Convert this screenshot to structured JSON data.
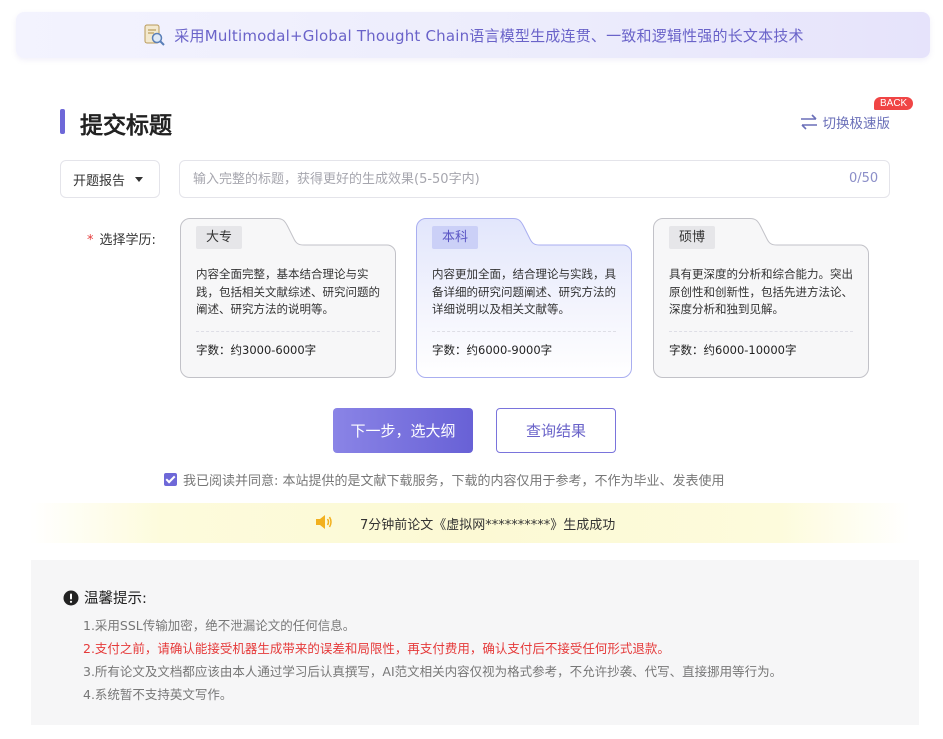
{
  "banner": {
    "icon": "document-magnifier-icon",
    "text": "采用Multimodal+Global Thought Chain语言模型生成连贯、一致和逻辑性强的长文本技术"
  },
  "header": {
    "title": "提交标题",
    "switch_label": "切换极速版",
    "back_badge": "BACK"
  },
  "form": {
    "type_select_value": "开题报告",
    "title_placeholder": "输入完整的标题，获得更好的生成效果(5-50字内)",
    "title_value": "",
    "counter": "0/50",
    "education_label": "选择学历:",
    "required_mark": "*"
  },
  "education_options": [
    {
      "tag": "大专",
      "description": "内容全面完整，基本结合理论与实践，包括相关文献综述、研究问题的阐述、研究方法的说明等。",
      "word_count": "字数：约3000-6000字",
      "selected": false
    },
    {
      "tag": "本科",
      "description": "内容更加全面，结合理论与实践，具备详细的研究问题阐述、研究方法的详细说明以及相关文献等。",
      "word_count": "字数：约6000-9000字",
      "selected": true
    },
    {
      "tag": "硕博",
      "description": "具有更深度的分析和综合能力。突出原创性和创新性，包括先进方法论、深度分析和独到见解。",
      "word_count": "字数：约6000-10000字",
      "selected": false
    }
  ],
  "actions": {
    "next_label": "下一步，选大纲",
    "query_label": "查询结果"
  },
  "agreement": {
    "checked": true,
    "text": "我已阅读并同意: 本站提供的是文献下载服务，下载的内容仅用于参考，不作为毕业、发表使用"
  },
  "notice": {
    "icon": "speaker-icon",
    "text": "7分钟前论文《虚拟网**********》生成成功"
  },
  "tips": {
    "icon": "exclamation-circle-icon",
    "title": "温馨提示:",
    "items": [
      "1.采用SSL传输加密，绝不泄漏论文的任何信息。",
      "2.支付之前，请确认能接受机器生成带来的误差和局限性，再支付费用，确认支付后不接受任何形式退款。",
      "3.所有论文及文档都应该由本人通过学习后认真撰写，AI范文相关内容仅视为格式参考，不允许抄袭、代写、直接挪用等行为。",
      "4.系统暂不支持英文写作。"
    ]
  },
  "colors": {
    "accent": "#6e68d8",
    "warning": "#e53a3a",
    "notice_bg": "#fcf9d4"
  }
}
